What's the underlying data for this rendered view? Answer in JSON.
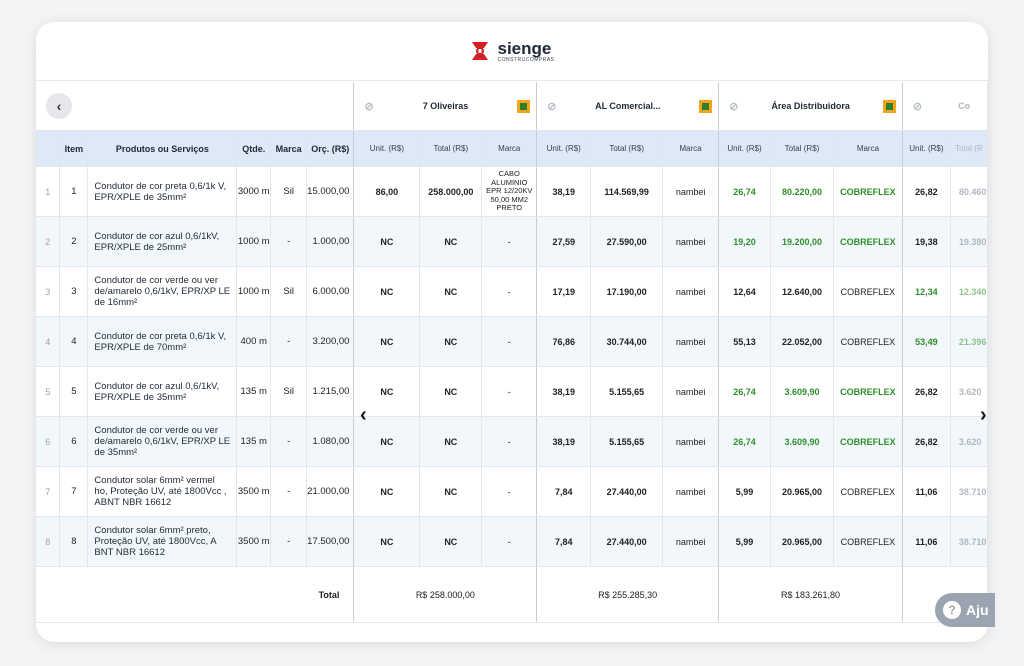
{
  "brand": {
    "name": "sienge",
    "sub": "CONSTRUCOMPRAS",
    "color": "#d31f26"
  },
  "suppliers": [
    {
      "name": "7 Oliveiras"
    },
    {
      "name": "AL Comercial..."
    },
    {
      "name": "Área Distribuidora"
    },
    {
      "name": "Co"
    }
  ],
  "headers": {
    "item": "Item",
    "produtos": "Produtos ou Serviços",
    "qtde": "Qtde.",
    "marca": "Marca",
    "orc": "Orç. (R$)",
    "unit": "Unit. (R$)",
    "total": "Total (R$)",
    "s_marca": "Marca",
    "total_partial": "Total (R"
  },
  "rows": [
    {
      "n": "1",
      "item": "1",
      "prod": "Condutor de cor preta 0,6/1k V, EPR/XPLE de 35mm²",
      "qtde": "3000 m",
      "marca": "Sil",
      "orc": "15.000,00",
      "s1": {
        "unit": "86,00",
        "total": "258.000,00",
        "marca": "CABO ALUMINIO EPR 12/20KV 50,00 MM2 PRETO"
      },
      "s2": {
        "unit": "38,19",
        "total": "114.569,99",
        "marca": "nambei"
      },
      "s3": {
        "unit": "26,74",
        "total": "80.220,00",
        "marca": "COBREFLEX"
      },
      "s4": {
        "unit": "26,82",
        "total": "80.460"
      }
    },
    {
      "n": "2",
      "item": "2",
      "prod": "Condutor de cor azul 0,6/1kV, EPR/XPLE de 25mm²",
      "qtde": "1000 m",
      "marca": "-",
      "orc": "1.000,00",
      "s1": {
        "unit": "NC",
        "total": "NC",
        "marca": "-"
      },
      "s2": {
        "unit": "27,59",
        "total": "27.590,00",
        "marca": "nambei"
      },
      "s3": {
        "unit": "19,20",
        "total": "19.200,00",
        "marca": "COBREFLEX"
      },
      "s4": {
        "unit": "19,38",
        "total": "19.380"
      }
    },
    {
      "n": "3",
      "item": "3",
      "prod": "Condutor de cor verde ou ver de/amarelo 0,6/1kV, EPR/XP LE de 16mm²",
      "qtde": "1000 m",
      "marca": "Sil",
      "orc": "6.000,00",
      "s1": {
        "unit": "NC",
        "total": "NC",
        "marca": "-"
      },
      "s2": {
        "unit": "17,19",
        "total": "17.190,00",
        "marca": "nambei"
      },
      "s3": {
        "unit": "12,64",
        "total": "12.640,00",
        "marca": "COBREFLEX"
      },
      "s4": {
        "unit": "12,34",
        "total": "12.340"
      }
    },
    {
      "n": "4",
      "item": "4",
      "prod": "Condutor de cor preta 0,6/1k V, EPR/XPLE de 70mm²",
      "qtde": "400 m",
      "marca": "-",
      "orc": "3.200,00",
      "s1": {
        "unit": "NC",
        "total": "NC",
        "marca": "-"
      },
      "s2": {
        "unit": "76,86",
        "total": "30.744,00",
        "marca": "nambei"
      },
      "s3": {
        "unit": "55,13",
        "total": "22.052,00",
        "marca": "COBREFLEX"
      },
      "s4": {
        "unit": "53,49",
        "total": "21.396"
      }
    },
    {
      "n": "5",
      "item": "5",
      "prod": "Condutor de cor azul 0,6/1kV, EPR/XPLE de 35mm²",
      "qtde": "135 m",
      "marca": "Sil",
      "orc": "1.215,00",
      "s1": {
        "unit": "NC",
        "total": "NC",
        "marca": "-"
      },
      "s2": {
        "unit": "38,19",
        "total": "5.155,65",
        "marca": "nambei"
      },
      "s3": {
        "unit": "26,74",
        "total": "3.609,90",
        "marca": "COBREFLEX"
      },
      "s4": {
        "unit": "26,82",
        "total": "3.620"
      }
    },
    {
      "n": "6",
      "item": "6",
      "prod": "Condutor de cor verde ou ver de/amarelo 0,6/1kV, EPR/XP LE de 35mm²",
      "qtde": "135 m",
      "marca": "-",
      "orc": "1.080,00",
      "s1": {
        "unit": "NC",
        "total": "NC",
        "marca": "-"
      },
      "s2": {
        "unit": "38,19",
        "total": "5.155,65",
        "marca": "nambei"
      },
      "s3": {
        "unit": "26,74",
        "total": "3.609,90",
        "marca": "COBREFLEX"
      },
      "s4": {
        "unit": "26,82",
        "total": "3.620"
      }
    },
    {
      "n": "7",
      "item": "7",
      "prod": "Condutor solar 6mm² vermel ho, Proteção UV, até 1800Vcc , ABNT NBR 16612",
      "qtde": "3500 m",
      "marca": "-",
      "orc": "21.000,00",
      "s1": {
        "unit": "NC",
        "total": "NC",
        "marca": "-"
      },
      "s2": {
        "unit": "7,84",
        "total": "27.440,00",
        "marca": "nambei"
      },
      "s3": {
        "unit": "5,99",
        "total": "20.965,00",
        "marca": "COBREFLEX"
      },
      "s4": {
        "unit": "11,06",
        "total": "38.710"
      }
    },
    {
      "n": "8",
      "item": "8",
      "prod": "Condutor solar 6mm² preto, Proteção UV, até 1800Vcc, A BNT NBR 16612",
      "qtde": "3500 m",
      "marca": "-",
      "orc": "17.500,00",
      "s1": {
        "unit": "NC",
        "total": "NC",
        "marca": "-"
      },
      "s2": {
        "unit": "7,84",
        "total": "27.440,00",
        "marca": "nambei"
      },
      "s3": {
        "unit": "5,99",
        "total": "20.965,00",
        "marca": "COBREFLEX"
      },
      "s4": {
        "unit": "11,06",
        "total": "38.710"
      }
    }
  ],
  "totals": {
    "label": "Total",
    "s1": "R$ 258.000,00",
    "s2": "R$ 255.285,30",
    "s3": "R$ 183.261,80"
  },
  "help_label": "Aju"
}
